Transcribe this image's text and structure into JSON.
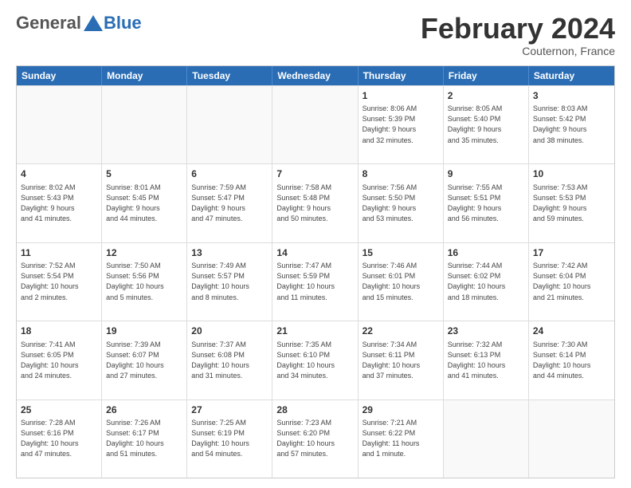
{
  "logo": {
    "general": "General",
    "blue": "Blue"
  },
  "header": {
    "title": "February 2024",
    "subtitle": "Couternon, France"
  },
  "weekdays": [
    "Sunday",
    "Monday",
    "Tuesday",
    "Wednesday",
    "Thursday",
    "Friday",
    "Saturday"
  ],
  "rows": [
    [
      {
        "day": "",
        "info": ""
      },
      {
        "day": "",
        "info": ""
      },
      {
        "day": "",
        "info": ""
      },
      {
        "day": "",
        "info": ""
      },
      {
        "day": "1",
        "info": "Sunrise: 8:06 AM\nSunset: 5:39 PM\nDaylight: 9 hours\nand 32 minutes."
      },
      {
        "day": "2",
        "info": "Sunrise: 8:05 AM\nSunset: 5:40 PM\nDaylight: 9 hours\nand 35 minutes."
      },
      {
        "day": "3",
        "info": "Sunrise: 8:03 AM\nSunset: 5:42 PM\nDaylight: 9 hours\nand 38 minutes."
      }
    ],
    [
      {
        "day": "4",
        "info": "Sunrise: 8:02 AM\nSunset: 5:43 PM\nDaylight: 9 hours\nand 41 minutes."
      },
      {
        "day": "5",
        "info": "Sunrise: 8:01 AM\nSunset: 5:45 PM\nDaylight: 9 hours\nand 44 minutes."
      },
      {
        "day": "6",
        "info": "Sunrise: 7:59 AM\nSunset: 5:47 PM\nDaylight: 9 hours\nand 47 minutes."
      },
      {
        "day": "7",
        "info": "Sunrise: 7:58 AM\nSunset: 5:48 PM\nDaylight: 9 hours\nand 50 minutes."
      },
      {
        "day": "8",
        "info": "Sunrise: 7:56 AM\nSunset: 5:50 PM\nDaylight: 9 hours\nand 53 minutes."
      },
      {
        "day": "9",
        "info": "Sunrise: 7:55 AM\nSunset: 5:51 PM\nDaylight: 9 hours\nand 56 minutes."
      },
      {
        "day": "10",
        "info": "Sunrise: 7:53 AM\nSunset: 5:53 PM\nDaylight: 9 hours\nand 59 minutes."
      }
    ],
    [
      {
        "day": "11",
        "info": "Sunrise: 7:52 AM\nSunset: 5:54 PM\nDaylight: 10 hours\nand 2 minutes."
      },
      {
        "day": "12",
        "info": "Sunrise: 7:50 AM\nSunset: 5:56 PM\nDaylight: 10 hours\nand 5 minutes."
      },
      {
        "day": "13",
        "info": "Sunrise: 7:49 AM\nSunset: 5:57 PM\nDaylight: 10 hours\nand 8 minutes."
      },
      {
        "day": "14",
        "info": "Sunrise: 7:47 AM\nSunset: 5:59 PM\nDaylight: 10 hours\nand 11 minutes."
      },
      {
        "day": "15",
        "info": "Sunrise: 7:46 AM\nSunset: 6:01 PM\nDaylight: 10 hours\nand 15 minutes."
      },
      {
        "day": "16",
        "info": "Sunrise: 7:44 AM\nSunset: 6:02 PM\nDaylight: 10 hours\nand 18 minutes."
      },
      {
        "day": "17",
        "info": "Sunrise: 7:42 AM\nSunset: 6:04 PM\nDaylight: 10 hours\nand 21 minutes."
      }
    ],
    [
      {
        "day": "18",
        "info": "Sunrise: 7:41 AM\nSunset: 6:05 PM\nDaylight: 10 hours\nand 24 minutes."
      },
      {
        "day": "19",
        "info": "Sunrise: 7:39 AM\nSunset: 6:07 PM\nDaylight: 10 hours\nand 27 minutes."
      },
      {
        "day": "20",
        "info": "Sunrise: 7:37 AM\nSunset: 6:08 PM\nDaylight: 10 hours\nand 31 minutes."
      },
      {
        "day": "21",
        "info": "Sunrise: 7:35 AM\nSunset: 6:10 PM\nDaylight: 10 hours\nand 34 minutes."
      },
      {
        "day": "22",
        "info": "Sunrise: 7:34 AM\nSunset: 6:11 PM\nDaylight: 10 hours\nand 37 minutes."
      },
      {
        "day": "23",
        "info": "Sunrise: 7:32 AM\nSunset: 6:13 PM\nDaylight: 10 hours\nand 41 minutes."
      },
      {
        "day": "24",
        "info": "Sunrise: 7:30 AM\nSunset: 6:14 PM\nDaylight: 10 hours\nand 44 minutes."
      }
    ],
    [
      {
        "day": "25",
        "info": "Sunrise: 7:28 AM\nSunset: 6:16 PM\nDaylight: 10 hours\nand 47 minutes."
      },
      {
        "day": "26",
        "info": "Sunrise: 7:26 AM\nSunset: 6:17 PM\nDaylight: 10 hours\nand 51 minutes."
      },
      {
        "day": "27",
        "info": "Sunrise: 7:25 AM\nSunset: 6:19 PM\nDaylight: 10 hours\nand 54 minutes."
      },
      {
        "day": "28",
        "info": "Sunrise: 7:23 AM\nSunset: 6:20 PM\nDaylight: 10 hours\nand 57 minutes."
      },
      {
        "day": "29",
        "info": "Sunrise: 7:21 AM\nSunset: 6:22 PM\nDaylight: 11 hours\nand 1 minute."
      },
      {
        "day": "",
        "info": ""
      },
      {
        "day": "",
        "info": ""
      }
    ]
  ]
}
